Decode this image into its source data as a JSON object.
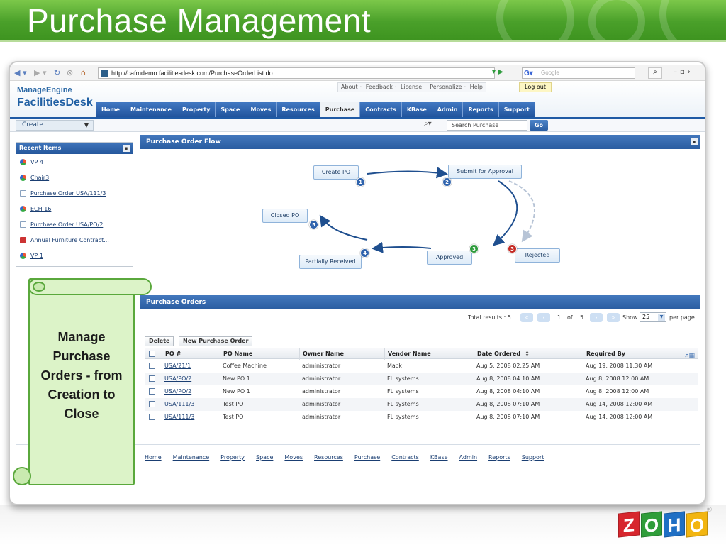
{
  "slide": {
    "title": "Purchase Management"
  },
  "browser": {
    "url": "http://cafmdemo.facilitiesdesk.com/PurchaseOrderList.do",
    "search_placeholder": "Google"
  },
  "app": {
    "logo_line1": "ManageEngine",
    "logo_line2": "FacilitiesDesk",
    "top_links": [
      "About",
      "Feedback",
      "License",
      "Personalize",
      "Help"
    ],
    "logout": "Log out",
    "tabs": [
      "Home",
      "Maintenance",
      "Property",
      "Space",
      "Moves",
      "Resources",
      "Purchase",
      "Contracts",
      "KBase",
      "Admin",
      "Reports",
      "Support"
    ],
    "active_tab": "Purchase",
    "create_label": "Create",
    "search_placeholder": "Search Purchase",
    "go_label": "Go"
  },
  "recent": {
    "title": "Recent Items",
    "items": [
      {
        "label": "VP 4",
        "icon": "asset-icon"
      },
      {
        "label": "Chair3",
        "icon": "asset-icon"
      },
      {
        "label": "Purchase Order USA/111/3",
        "icon": "po-icon"
      },
      {
        "label": "ECH 16",
        "icon": "asset-icon"
      },
      {
        "label": "Purchase Order USA/PO/2",
        "icon": "po-icon"
      },
      {
        "label": "Annual Furniture Contract...",
        "icon": "contract-icon"
      },
      {
        "label": "VP 1",
        "icon": "asset-icon"
      }
    ]
  },
  "flow": {
    "title": "Purchase Order Flow",
    "nodes": [
      {
        "label": "Create PO",
        "step": "1"
      },
      {
        "label": "Submit for Approval",
        "step": "2"
      },
      {
        "label": "Approved",
        "step": "3"
      },
      {
        "label": "Rejected",
        "step": "3"
      },
      {
        "label": "Partially Received",
        "step": "4"
      },
      {
        "label": "Closed PO",
        "step": "5"
      }
    ]
  },
  "orders": {
    "title": "Purchase Orders",
    "results_label": "Total results : 5",
    "page": "1",
    "of_label": "of",
    "total_pages": "5",
    "show_label": "Show",
    "per_page": "25",
    "per_page_label": "per page",
    "delete_label": "Delete",
    "new_label": "New Purchase Order",
    "columns": [
      "PO #",
      "PO Name",
      "Owner Name",
      "Vendor Name",
      "Date Ordered",
      "Required By"
    ],
    "rows": [
      [
        "USA/21/1",
        "Coffee Machine",
        "administrator",
        "Mack",
        "Aug 5, 2008 02:25 AM",
        "Aug 19, 2008 11:30 AM"
      ],
      [
        "USA/PO/2",
        "New PO 1",
        "administrator",
        "FL systems",
        "Aug 8, 2008 04:10 AM",
        "Aug 8, 2008 12:00 AM"
      ],
      [
        "USA/PO/2",
        "New PO 1",
        "administrator",
        "FL systems",
        "Aug 8, 2008 04:10 AM",
        "Aug 8, 2008 12:00 AM"
      ],
      [
        "USA/111/3",
        "Test PO",
        "administrator",
        "FL systems",
        "Aug 8, 2008 07:10 AM",
        "Aug 14, 2008 12:00 AM"
      ],
      [
        "USA/111/3",
        "Test PO",
        "administrator",
        "FL systems",
        "Aug 8, 2008 07:10 AM",
        "Aug 14, 2008 12:00 AM"
      ]
    ]
  },
  "footer_links": [
    "Home",
    "Maintenance",
    "Property",
    "Space",
    "Moves",
    "Resources",
    "Purchase",
    "Contracts",
    "KBase",
    "Admin",
    "Reports",
    "Support"
  ],
  "callout": {
    "text": "Manage Purchase Orders - from Creation to Close"
  },
  "brand": {
    "letters": [
      "Z",
      "O",
      "H",
      "O"
    ],
    "reg": "®"
  },
  "colors": {
    "slide_green": "#4aa02a",
    "nav_blue": "#21549d",
    "callout_fill": "#dcf3c8",
    "callout_border": "#5aa83c"
  }
}
